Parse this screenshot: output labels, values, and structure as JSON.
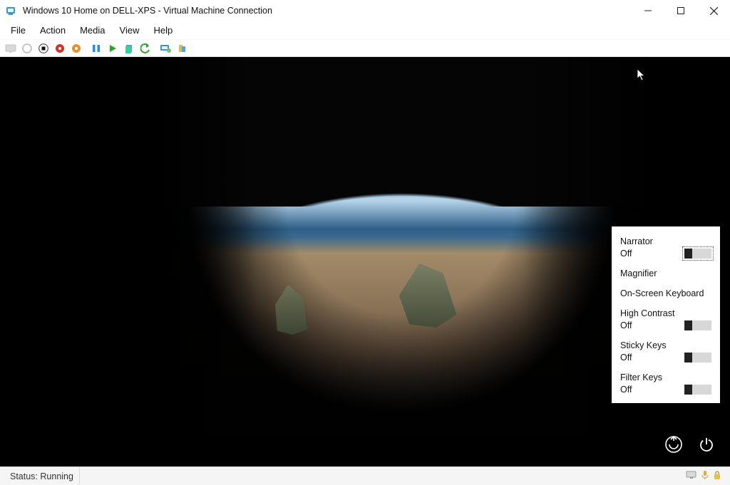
{
  "window": {
    "title": "Windows 10 Home on DELL-XPS - Virtual Machine Connection"
  },
  "menubar": {
    "items": [
      "File",
      "Action",
      "Media",
      "View",
      "Help"
    ]
  },
  "toolbar": {
    "icons": [
      "ctrl-alt-del",
      "power-circle",
      "stop",
      "shutdown-red",
      "reset-orange",
      "sep",
      "pause",
      "start",
      "revert",
      "undo",
      "sep",
      "enhanced-session",
      "share"
    ]
  },
  "ease_of_access": {
    "items": [
      {
        "label": "Narrator",
        "state": "Off",
        "has_toggle": true,
        "focused": true
      },
      {
        "label": "Magnifier",
        "state": "",
        "has_toggle": false
      },
      {
        "label": "On-Screen Keyboard",
        "state": "",
        "has_toggle": false
      },
      {
        "label": "High Contrast",
        "state": "Off",
        "has_toggle": true
      },
      {
        "label": "Sticky Keys",
        "state": "Off",
        "has_toggle": true
      },
      {
        "label": "Filter Keys",
        "state": "Off",
        "has_toggle": true
      }
    ]
  },
  "status": {
    "text": "Status: Running"
  }
}
